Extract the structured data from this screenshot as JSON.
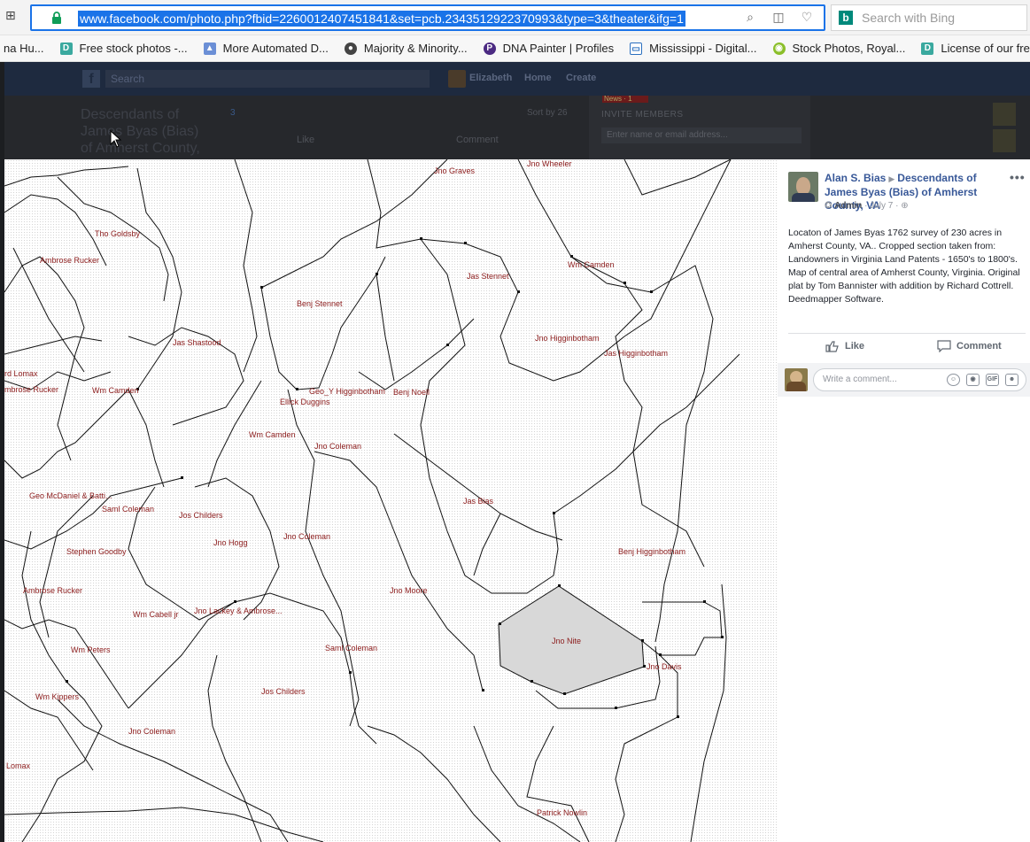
{
  "browser": {
    "url": "www.facebook.com/photo.php?fbid=2260012407451841&set=pcb.2343512922370993&type=3&theater&ifg=1",
    "search_placeholder": "Search with Bing",
    "apps_icon": "apps-grid-icon"
  },
  "bookmarks": [
    {
      "label": "na Hu...",
      "icon": "none",
      "color": ""
    },
    {
      "label": "Free stock photos -...",
      "icon": "D",
      "color": "#3aa99f"
    },
    {
      "label": "More Automated D...",
      "icon": "img",
      "color": "#6b8fd6"
    },
    {
      "label": "Majority & Minority...",
      "icon": "circle",
      "color": "#444444"
    },
    {
      "label": "DNA Painter | Profiles",
      "icon": "P",
      "color": "#4b2a82"
    },
    {
      "label": "Mississippi - Digital...",
      "icon": "frame",
      "color": "#2a6fbf"
    },
    {
      "label": "Stock Photos, Royal...",
      "icon": "circle",
      "color": "#8bbf2a"
    },
    {
      "label": "License of our free...",
      "icon": "D",
      "color": "#3aa99f"
    }
  ],
  "fb_background": {
    "search_placeholder": "Search",
    "user_name": "Elizabeth",
    "nav_home": "Home",
    "nav_create": "Create",
    "group_title": "Descendants of James Byas (Bias) of Amherst County,",
    "reaction_count": "3",
    "like_label": "Like",
    "comment_label": "Comment",
    "sort_label": "Sort by 26",
    "invite_title": "INVITE MEMBERS",
    "invite_placeholder": "Enter name or email address...",
    "news_badge": "News · 1"
  },
  "map_labels": [
    "Jno Graves",
    "Jno Wheeler",
    "Tho Goldsby",
    "Ambrose Rucker",
    "Wm Camden",
    "Jas Stennet",
    "Benj Stennet",
    "Jas Shastood",
    "Jno Higginbotham",
    "Jas Higginbotham",
    "rd Lomax",
    "mbrose Rucker",
    "Wm Camden",
    "Geo_Y Higginbotham",
    "Benj Noell",
    "Ellick Duggins",
    "Wm Camden",
    "Jno Coleman",
    "Geo McDaniel & Batti...",
    "Saml Coleman",
    "Jos Childers",
    "Jas Bias",
    "Jno Hogg",
    "Jno Coleman",
    "Stephen Goodby",
    "Benj Higginbotham",
    "Ambrose Rucker",
    "Jno Moore",
    "Wm Cabell jr",
    "Jno Lackey & Ambrose...",
    "Jno Nite",
    "Wm Peters",
    "Saml Coleman",
    "Jno Davis",
    "Jos Childers",
    "Wm Kippers",
    "Jno Coleman",
    "Lomax",
    "Patrick Nowlin"
  ],
  "post": {
    "author": "Alan S. Bias",
    "group": "Descendants of James Byas (Bias) of Amherst County, VA",
    "role": "Admin",
    "date": "July 7",
    "body": "Locaton of James Byas 1762 survey of 230 acres in Amherst County, VA.. Cropped section taken from: Landowners in Virginia Land Patents - 1650's to 1800's. Map of central area of Amherst County, Virginia. Original plat by Tom Bannister with addition by Richard Cottrell. Deedmapper Software.",
    "like_label": "Like",
    "comment_label": "Comment",
    "comment_placeholder": "Write a comment...",
    "comment_icons": [
      "emoji-icon",
      "camera-icon",
      "gif-icon",
      "sticker-icon"
    ]
  }
}
